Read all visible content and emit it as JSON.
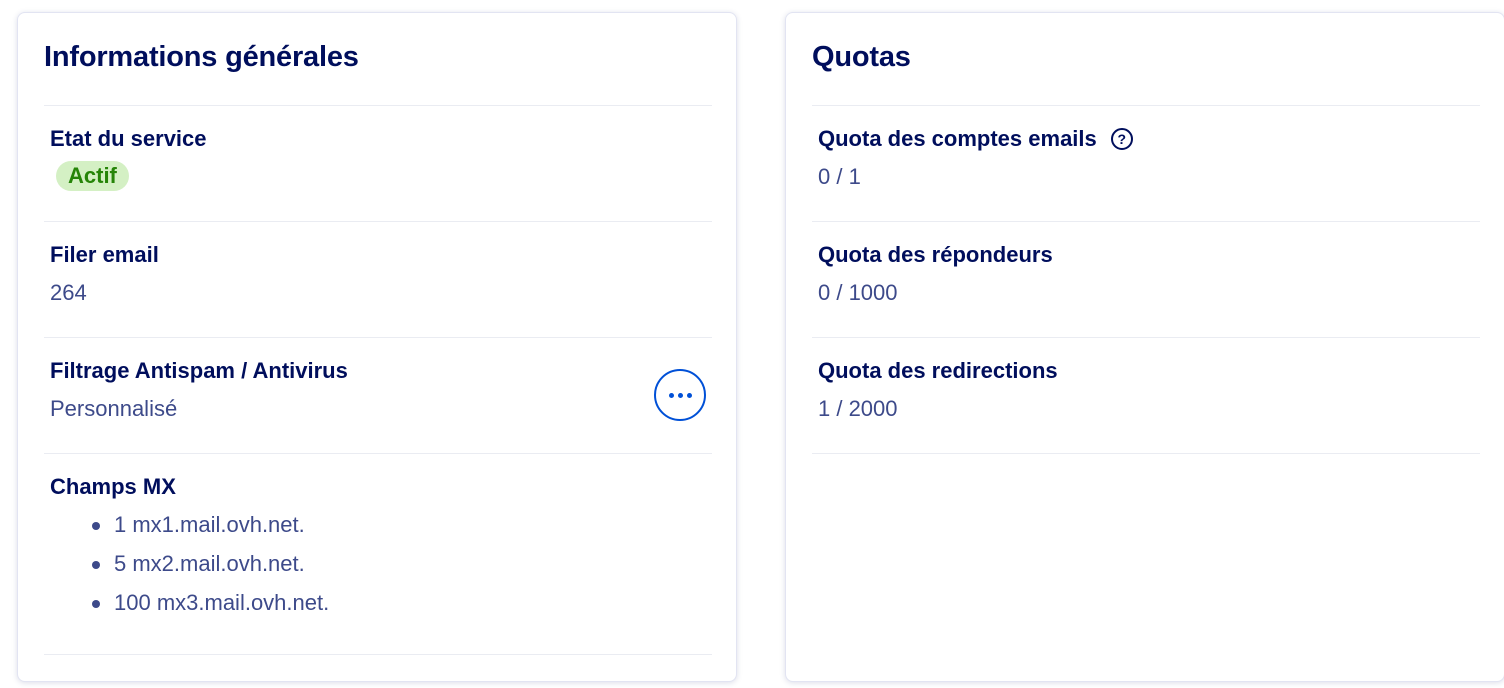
{
  "general": {
    "title": "Informations générales",
    "service_state": {
      "label": "Etat du service",
      "badge": "Actif",
      "badge_color": "#268508",
      "badge_bg": "#d4f0c4"
    },
    "filer": {
      "label": "Filer email",
      "value": "264"
    },
    "filtering": {
      "label": "Filtrage Antispam / Antivirus",
      "value": "Personnalisé",
      "action_icon": "more-horizontal-icon"
    },
    "mx": {
      "label": "Champs MX",
      "records": [
        "1 mx1.mail.ovh.net.",
        "5 mx2.mail.ovh.net.",
        "100 mx3.mail.ovh.net."
      ]
    }
  },
  "quotas": {
    "title": "Quotas",
    "items": [
      {
        "label": "Quota des comptes emails",
        "value": "0 / 1",
        "help_icon": "question-circle-icon",
        "help_glyph": "?"
      },
      {
        "label": "Quota des répondeurs",
        "value": "0 / 1000"
      },
      {
        "label": "Quota des redirections",
        "value": "1 / 2000"
      }
    ]
  },
  "colors": {
    "heading": "#000e5c",
    "text": "#3d4a8a",
    "accent": "#0050d7",
    "divider": "#eaecf2"
  }
}
